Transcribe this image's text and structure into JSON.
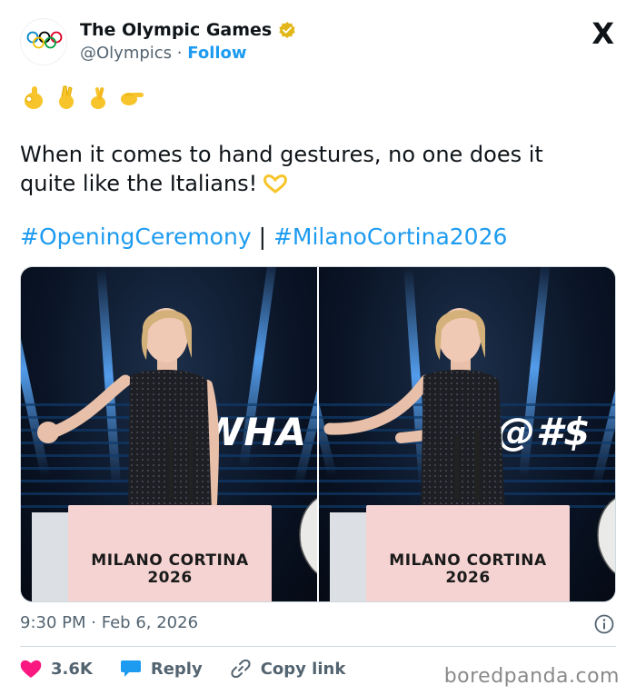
{
  "account": {
    "name": "The Olympic Games",
    "handle": "@Olympics",
    "separator": "·",
    "follow_label": "Follow"
  },
  "brand": {
    "x_logo": "X"
  },
  "tweet": {
    "emojis": [
      "ok-hand-emoji",
      "pinched-fingers-emoji",
      "crossed-fingers-emoji",
      "pointing-hand-emoji"
    ],
    "text": "When it comes to hand gestures, no one does it quite like the Italians!",
    "hashtag_1": "#OpeningCeremony",
    "hashtag_separator": "|",
    "hashtag_2": "#MilanoCortina2026"
  },
  "media": {
    "left": {
      "overlay_text": "WHA",
      "podium_line1": "MILANO CORTINA",
      "podium_line2": "2026"
    },
    "right": {
      "overlay_text": "@#$",
      "podium_line1": "MILANO CORTINA",
      "podium_line2": "2026"
    }
  },
  "meta": {
    "time": "9:30 PM",
    "separator": "·",
    "date": "Feb 6, 2026"
  },
  "actions": {
    "likes": "3.6K",
    "reply_label": "Reply",
    "copy_link_label": "Copy link"
  },
  "watermark": "boredpanda.com",
  "colors": {
    "accent": "#1d9bf0",
    "heart": "#f91880",
    "text": "#0f1419",
    "muted": "#536471"
  }
}
